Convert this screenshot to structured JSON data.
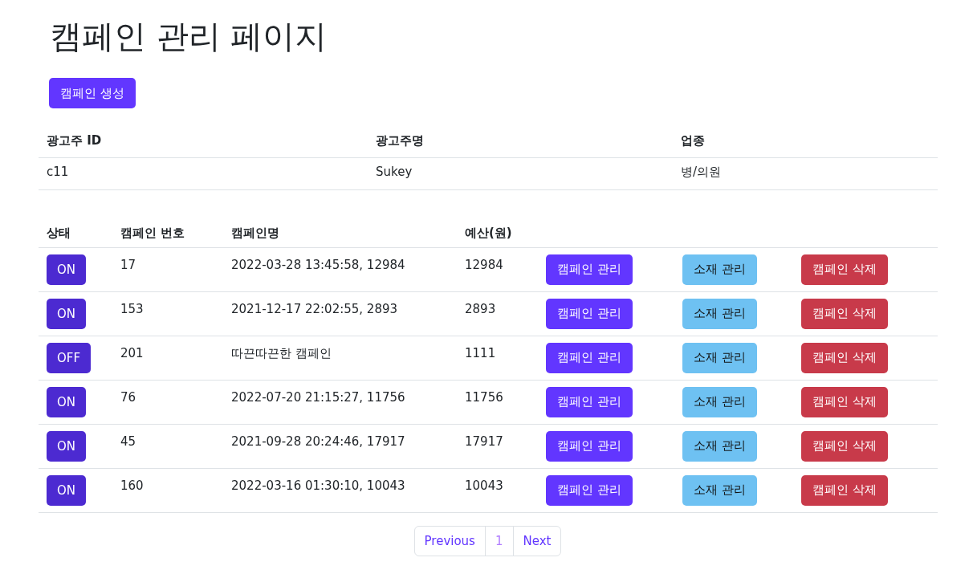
{
  "title": "캠페인 관리 페이지",
  "create_button": "캠페인 생성",
  "advertiser_table": {
    "columns": [
      "광고주 ID",
      "광고주명",
      "업종"
    ],
    "rows": [
      [
        "c11",
        "Sukey",
        "병/의원"
      ]
    ]
  },
  "campaign_table": {
    "columns": [
      "상태",
      "캠페인 번호",
      "캠페인명",
      "예산(원)"
    ],
    "rows": [
      {
        "status": "ON",
        "number": "17",
        "name": "2022-03-28 13:45:58, 12984",
        "budget": "12984",
        "actions": [
          "캠페인 관리",
          "소재 관리",
          "캠페인 삭제"
        ]
      },
      {
        "status": "ON",
        "number": "153",
        "name": "2021-12-17 22:02:55, 2893",
        "budget": "2893",
        "actions": [
          "캠페인 관리",
          "소재 관리",
          "캠페인 삭제"
        ]
      },
      {
        "status": "OFF",
        "number": "201",
        "name": "따끈따끈한 캠페인",
        "budget": "1111",
        "actions": [
          "캠페인 관리",
          "소재 관리",
          "캠페인 삭제"
        ]
      },
      {
        "status": "ON",
        "number": "76",
        "name": "2022-07-20 21:15:27, 11756",
        "budget": "11756",
        "actions": [
          "캠페인 관리",
          "소재 관리",
          "캠페인 삭제"
        ]
      },
      {
        "status": "ON",
        "number": "45",
        "name": "2021-09-28 20:24:46, 17917",
        "budget": "17917",
        "actions": [
          "캠페인 관리",
          "소재 관리",
          "캠페인 삭제"
        ]
      },
      {
        "status": "ON",
        "number": "160",
        "name": "2022-03-16 01:30:10, 10043",
        "budget": "10043",
        "actions": [
          "캠페인 관리",
          "소재 관리",
          "캠페인 삭제"
        ]
      }
    ]
  },
  "pagination": {
    "previous": "Previous",
    "pages": [
      {
        "label": "1",
        "selected": true
      }
    ],
    "next": "Next"
  }
}
